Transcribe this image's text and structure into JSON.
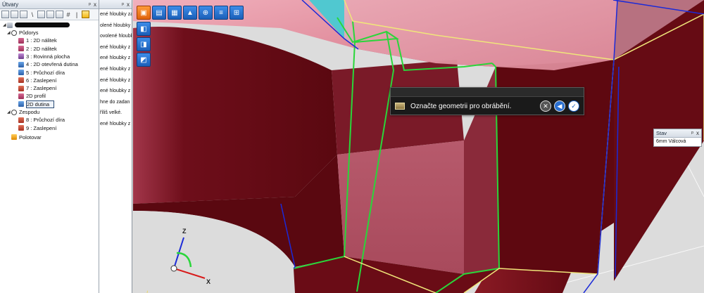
{
  "tree_panel": {
    "title": "Útvary",
    "pin": "ᵖ",
    "close": "x",
    "toolbar_text_1": "\\",
    "toolbar_text_2": "#",
    "toolbar_text_3": "|",
    "nodes": [
      {
        "label": "Půdorys",
        "icon": "gear-icon",
        "indent": 1,
        "twisty": "◢"
      },
      {
        "label": "1 : 2D nálitek",
        "icon": "pink",
        "indent": 2
      },
      {
        "label": "2 : 2D nálitek",
        "icon": "pink",
        "indent": 2
      },
      {
        "label": "3 : Rovinná plocha",
        "icon": "purple",
        "indent": 2
      },
      {
        "label": "4 : 2D otevřená dutina",
        "icon": "blue",
        "indent": 2
      },
      {
        "label": "5 : Průchozí díra",
        "icon": "blue",
        "indent": 2
      },
      {
        "label": "6 : Zaslepení",
        "icon": "red",
        "indent": 2
      },
      {
        "label": "7 : Zaslepení",
        "icon": "red",
        "indent": 2
      },
      {
        "label": "2D profil",
        "icon": "pink",
        "indent": 2
      },
      {
        "label": "2D dutina",
        "icon": "blue",
        "indent": 2,
        "selected": true
      },
      {
        "label": "Zespodu",
        "icon": "gear-icon",
        "indent": 1,
        "twisty": "◢"
      },
      {
        "label": "8 : Průchozí díra",
        "icon": "red",
        "indent": 2
      },
      {
        "label": "9 : Zaslepení",
        "icon": "red",
        "indent": 2
      },
      {
        "label": "Polotovar",
        "icon": "orange",
        "indent": 0
      }
    ]
  },
  "msg_panel": {
    "pin": "ᵖ",
    "close": "x",
    "lines": [
      "ené hloubky za",
      "olené hloubky z",
      "ovolené hloubk",
      "ené hloubky z",
      "ené hloubky z",
      "ené hloubky z",
      "ené hloubky z",
      "ené hloubky z",
      "hne do zadan",
      "říliš velké.",
      "ené hloubky z"
    ]
  },
  "prompt": {
    "text": "Označte geometrii pro obrábění."
  },
  "stav": {
    "title": "Stav",
    "pin": "ᵖ",
    "close": "x",
    "value": "6mm Válcová"
  },
  "axes": {
    "z": "Z",
    "x": "X"
  },
  "colors": {
    "solid_face": "#6b0a10",
    "top_face": "#e79aa8",
    "pocket_face": "#a94a5c",
    "edge_green": "#2ad63a",
    "edge_yellow": "#f0e67a",
    "edge_blue": "#1b2ad8",
    "background": "#dcdcdc"
  }
}
